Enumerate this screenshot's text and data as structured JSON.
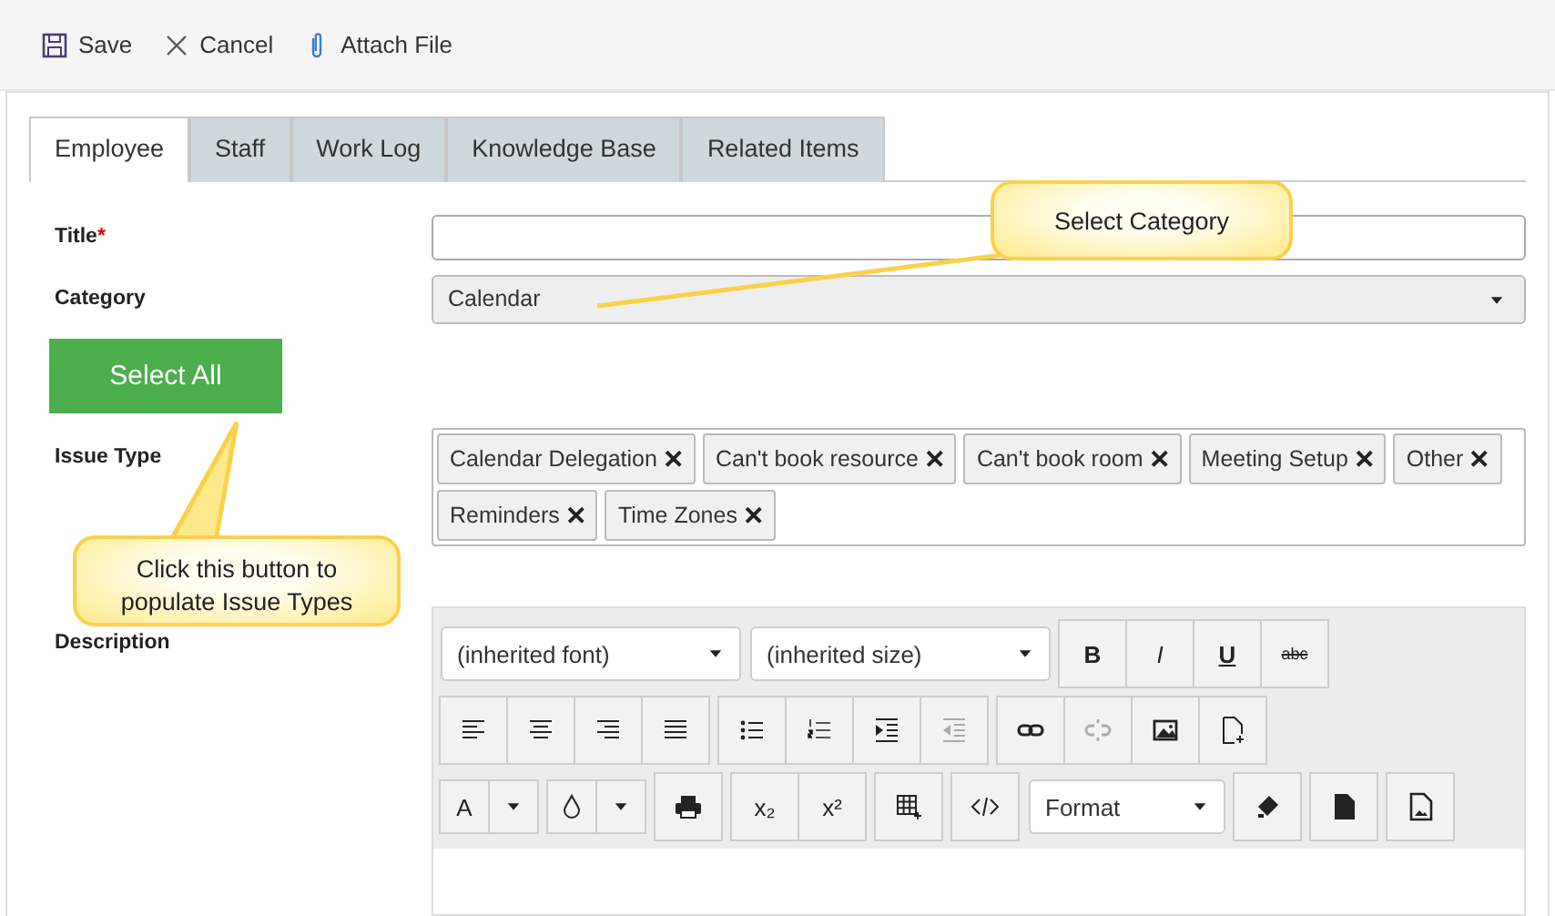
{
  "toolbar": [
    {
      "kind": "save",
      "label": "Save"
    },
    {
      "kind": "cancel",
      "label": "Cancel"
    },
    {
      "kind": "attach",
      "label": "Attach File"
    }
  ],
  "tabs": [
    {
      "label": "Employee",
      "selected": true
    },
    {
      "label": "Staff",
      "selected": false
    },
    {
      "label": "Work Log",
      "selected": false
    },
    {
      "label": "Knowledge Base",
      "selected": false
    },
    {
      "label": "Related Items",
      "selected": false
    }
  ],
  "form": {
    "title": {
      "label": "Title",
      "required_mark": "*"
    },
    "category": {
      "label": "Category",
      "value": "Calendar"
    },
    "select_all_button": "Select All",
    "issue_type": {
      "label": "Issue Type",
      "tags": [
        "Calendar Delegation",
        "Can't book resource",
        "Can't book room",
        "Meeting Setup",
        "Other",
        "Reminders",
        "Time Zones"
      ],
      "remove_glyph": "✕"
    },
    "description": {
      "label": "Description"
    }
  },
  "editor": {
    "font_select": "(inherited font)",
    "size_select": "(inherited size)",
    "format_select": "Format",
    "rows": [
      [
        {
          "group": [
            {
              "kind": "bold",
              "text": "B"
            },
            {
              "kind": "italic",
              "text": "I"
            },
            {
              "kind": "underline",
              "text": "U"
            },
            {
              "kind": "strike",
              "text": "abc"
            }
          ]
        }
      ],
      [
        {
          "group": [
            {
              "kind": "align-left"
            },
            {
              "kind": "align-center"
            },
            {
              "kind": "align-right"
            },
            {
              "kind": "justify"
            }
          ]
        },
        {
          "group": [
            {
              "kind": "bullets"
            },
            {
              "kind": "numbers"
            },
            {
              "kind": "indent"
            },
            {
              "kind": "outdent",
              "disabled": true
            }
          ]
        },
        {
          "group": [
            {
              "kind": "link"
            },
            {
              "kind": "unlink",
              "disabled": true
            },
            {
              "kind": "image"
            },
            {
              "kind": "new-doc"
            }
          ]
        }
      ],
      [
        {
          "group": [
            {
              "kind": "text-color",
              "text": "A"
            }
          ]
        },
        {
          "group": [
            {
              "kind": "fill"
            }
          ]
        },
        {
          "group": [
            {
              "kind": "print"
            }
          ]
        },
        {
          "group": [
            {
              "kind": "sub",
              "text": "x₂"
            },
            {
              "kind": "sup",
              "text": "x²"
            }
          ]
        },
        {
          "group": [
            {
              "kind": "table"
            }
          ]
        },
        {
          "group": [
            {
              "kind": "code"
            }
          ]
        },
        {
          "group": [
            {
              "kind": "format"
            }
          ]
        },
        {
          "group": [
            {
              "kind": "eraser"
            }
          ]
        },
        {
          "group": [
            {
              "kind": "document"
            }
          ]
        },
        {
          "group": [
            {
              "kind": "image-file"
            }
          ]
        }
      ]
    ]
  },
  "callouts": [
    {
      "kind": "category",
      "text": "Select Category"
    },
    {
      "kind": "button",
      "text": "Click this button to populate Issue Types"
    }
  ]
}
